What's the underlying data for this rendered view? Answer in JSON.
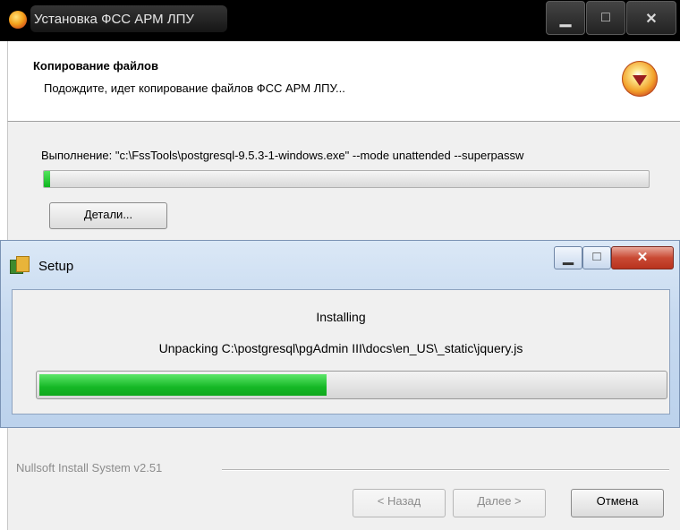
{
  "installer": {
    "title": "Установка ФСС АРМ ЛПУ",
    "header_title": "Копирование файлов",
    "header_subtitle": "Подождите, идет копирование файлов ФСС АРМ ЛПУ...",
    "exec_line": "Выполнение: \"c:\\FssTools\\postgresql-9.5.3-1-windows.exe\" --mode unattended --superpassw",
    "progress": 0.01,
    "details_label": "Детали...",
    "branding": "Nullsoft Install System v2.51",
    "back_label": "< Назад",
    "next_label": "Далее >",
    "cancel_label": "Отмена",
    "icons": {
      "title": "installer-disc-icon",
      "header": "installer-logo-icon"
    }
  },
  "setup": {
    "title": "Setup",
    "status": "Installing",
    "detail": "Unpacking C:\\postgresql\\pgAdmin III\\docs\\en_US\\_static\\jquery.js",
    "progress": 0.46,
    "icons": {
      "title": "setup-package-icon"
    }
  },
  "colors": {
    "progress_green": "#16b826",
    "titlebar_dark": "#000000",
    "setup_frame": "#c7daf0",
    "close_red": "#c94a34"
  }
}
